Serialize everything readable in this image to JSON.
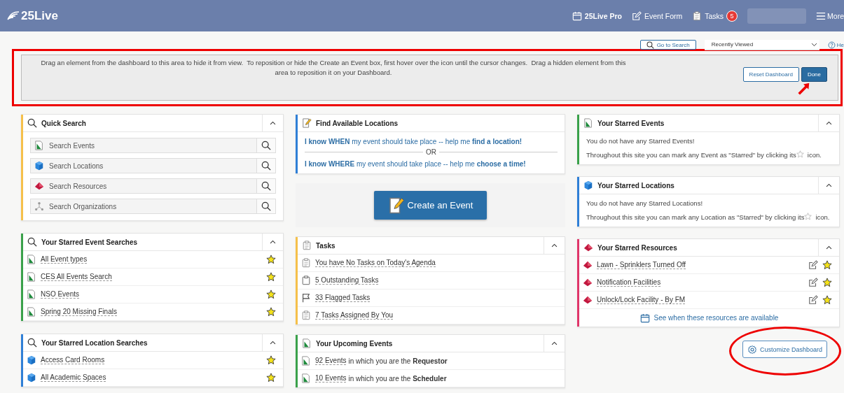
{
  "header": {
    "logo": "25Live",
    "nav": [
      {
        "label": "25Live Pro",
        "kind": "calendar",
        "bold": true
      },
      {
        "label": "Event Form",
        "kind": "edit",
        "bold": false
      },
      {
        "label": "Tasks",
        "kind": "clipboard",
        "bold": false,
        "badge": "5"
      }
    ],
    "more": "More"
  },
  "toolbar": {
    "search_button": "Go to Search",
    "recent": "Recently Viewed",
    "help": "He"
  },
  "customize_panel": {
    "message": "Drag an element from the dashboard to this area to hide it from view.  To reposition or hide the Create an Event box, first hover over the icon until the cursor changes.  Drag a hidden element from this area to reposition it on your Dashboard.",
    "buttons": [
      {
        "label": "Reset Dashboard",
        "kind": "secondary"
      },
      {
        "label": "Done",
        "kind": "primary"
      }
    ]
  },
  "columns": [
    [
      {
        "kind": "quick_search",
        "title": "Quick Search",
        "color": "#f5c04a",
        "expanded": true,
        "items": [
          {
            "placeholder": "Search Events",
            "kind": "event"
          },
          {
            "placeholder": "Search Locations",
            "kind": "location"
          },
          {
            "placeholder": "Search Resources",
            "kind": "resource"
          },
          {
            "placeholder": "Search Organizations",
            "kind": "organization"
          }
        ]
      },
      {
        "kind": "search_list",
        "title": "Your Starred Event Searches",
        "color": "#3aa14a",
        "expanded": true,
        "items": [
          {
            "label": "All Event types",
            "kind": "event",
            "starred": true
          },
          {
            "label": "CES All Events Search",
            "kind": "event",
            "starred": true
          },
          {
            "label": "NSO Events",
            "kind": "event",
            "starred": true
          },
          {
            "label": "Spring 20 Missing Finals",
            "kind": "event",
            "starred": true
          }
        ]
      },
      {
        "kind": "search_list",
        "title": "Your Starred Location Searches",
        "color": "#2f7fd6",
        "expanded": true,
        "items": [
          {
            "label": "Access Card Rooms",
            "kind": "location",
            "starred": true
          },
          {
            "label": "All Academic Spaces",
            "kind": "location",
            "starred": true
          }
        ]
      }
    ],
    [
      {
        "kind": "find",
        "title": "Find Available Locations",
        "color": "#2f7fd6",
        "lines": [
          "**I know WHEN** my event should take place -- help me **find a location!**",
          "**I know WHERE** my event should take place -- help me **choose a time!**"
        ],
        "divider": "OR"
      },
      {
        "kind": "create",
        "label": "Create an Event"
      },
      {
        "kind": "task_list",
        "title": "Tasks",
        "color": "#f5c04a",
        "expanded": true,
        "items": [
          {
            "label": "You have No Tasks on Today's Agenda",
            "kind": "clipboard"
          },
          {
            "label": "5 Outstanding Tasks",
            "kind": "box"
          },
          {
            "label": "33 Flagged Tasks",
            "kind": "flag"
          },
          {
            "label": "7 Tasks Assigned By You",
            "kind": "clipboard"
          }
        ]
      },
      {
        "kind": "upcoming",
        "title": "Your Upcoming Events",
        "color": "#3aa14a",
        "expanded": true,
        "items": [
          {
            "link": "92 Events",
            "text": "in which you are the **Requestor**",
            "kind": "event"
          },
          {
            "link": "10 Events",
            "text": "in which you are the **Scheduler**",
            "kind": "event"
          }
        ]
      }
    ],
    [
      {
        "kind": "empty_events",
        "title": "Your Starred Events",
        "color": "#3aa14a",
        "expanded": true,
        "message": "You do not have any Starred Events!",
        "note": "Throughout this site you can mark any Event as \"Starred\" by clicking its",
        "note_end": "icon."
      },
      {
        "kind": "empty_locations",
        "title": "Your Starred Locations",
        "color": "#2f7fd6",
        "expanded": true,
        "message": "You do not have any Starred Locations!",
        "note": "Throughout this site you can mark any Location as \"Starred\" by clicking its",
        "note_end": "icon."
      },
      {
        "kind": "resource_list",
        "title": "Your Starred Resources",
        "color": "#e0366a",
        "expanded": true,
        "items": [
          {
            "label": "Lawn - Sprinklers Turned Off",
            "kind": "resource",
            "starred": true,
            "editable": true
          },
          {
            "label": "Notification Facilities",
            "kind": "resource",
            "starred": true,
            "editable": true
          },
          {
            "label": "Unlock/Lock Facility - By FM",
            "kind": "resource",
            "starred": true,
            "editable": true
          }
        ],
        "footer_link": "See when these resources are available"
      }
    ]
  ],
  "customize_button": "Customize Dashboard"
}
